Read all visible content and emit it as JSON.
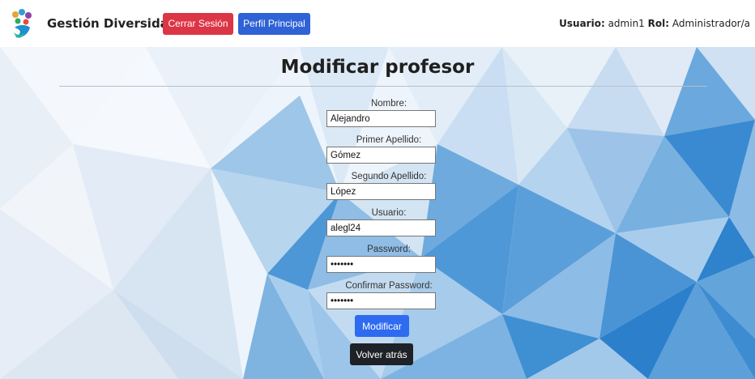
{
  "navbar": {
    "brand": "Gestión Diversidad",
    "logout_label": "Cerrar Sesión",
    "profile_label": "Perfil Principal",
    "user_label": "Usuario:",
    "user_value": "admin1",
    "role_label": "Rol:",
    "role_value": "Administrador/a"
  },
  "page": {
    "title": "Modificar profesor"
  },
  "form": {
    "nombre_label": "Nombre:",
    "nombre_value": "Alejandro",
    "apellido1_label": "Primer Apellido:",
    "apellido1_value": "Gómez",
    "apellido2_label": "Segundo Apellido:",
    "apellido2_value": "López",
    "usuario_label": "Usuario:",
    "usuario_value": "alegl24",
    "password_label": "Password:",
    "password_value": "•••••••",
    "confirm_label": "Confirmar Password:",
    "confirm_value": "•••••••",
    "submit_label": "Modificar",
    "back_label": "Volver atrás"
  },
  "colors": {
    "logout": "#dc3545",
    "profile": "#2f62d6",
    "submit": "#2f6bf0",
    "back": "#1e2226",
    "background_accent": "#5ba3dc"
  }
}
